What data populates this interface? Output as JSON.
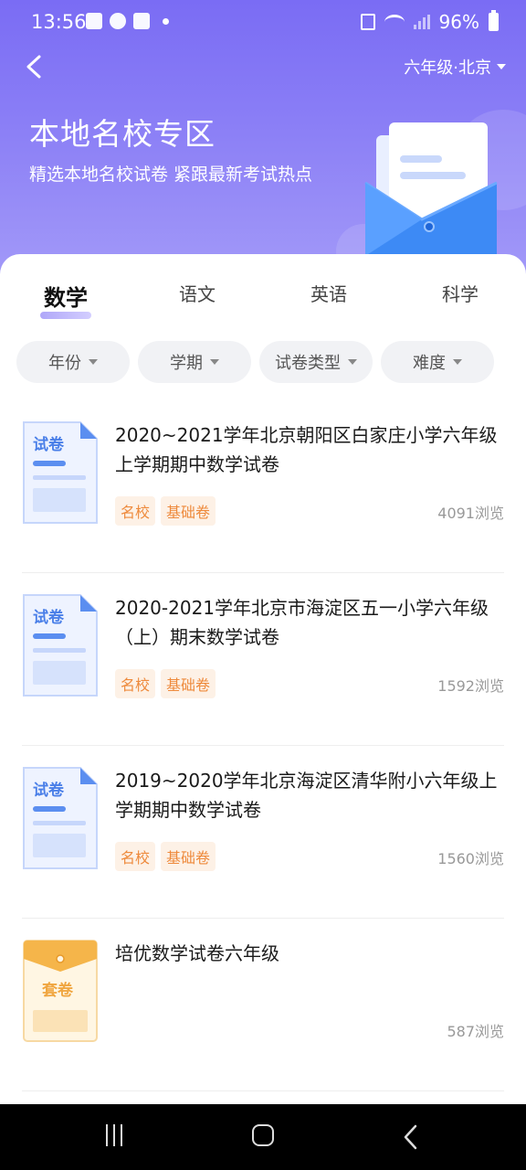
{
  "status_bar": {
    "time": "13:56",
    "battery": "96%"
  },
  "header": {
    "region_label": "六年级·北京",
    "title": "本地名校专区",
    "subtitle": "精选本地名校试卷 紧跟最新考试热点"
  },
  "tabs": [
    {
      "label": "数学",
      "active": true
    },
    {
      "label": "语文",
      "active": false
    },
    {
      "label": "英语",
      "active": false
    },
    {
      "label": "科学",
      "active": false
    }
  ],
  "filters": [
    {
      "label": "年份"
    },
    {
      "label": "学期"
    },
    {
      "label": "试卷类型"
    },
    {
      "label": "难度"
    }
  ],
  "items": [
    {
      "icon_label": "试卷",
      "title": "2020~2021学年北京朝阳区白家庄小学六年级上学期期中数学试卷",
      "tags": [
        "名校",
        "基础卷"
      ],
      "views": "4091浏览"
    },
    {
      "icon_label": "试卷",
      "title": "2020-2021学年北京市海淀区五一小学六年级（上）期末数学试卷",
      "tags": [
        "名校",
        "基础卷"
      ],
      "views": "1592浏览"
    },
    {
      "icon_label": "试卷",
      "title": "2019~2020学年北京海淀区清华附小六年级上学期期中数学试卷",
      "tags": [
        "名校",
        "基础卷"
      ],
      "views": "1560浏览"
    },
    {
      "icon_label": "套卷",
      "title": "培优数学试卷六年级",
      "tags": [],
      "views": "587浏览"
    }
  ],
  "colors": {
    "accent": "#7a6cf4",
    "tag_bg": "#fdf1e6",
    "tag_text": "#ee8a3c",
    "paper_blue": "#5b8ef0",
    "set_orange": "#f0a640"
  }
}
